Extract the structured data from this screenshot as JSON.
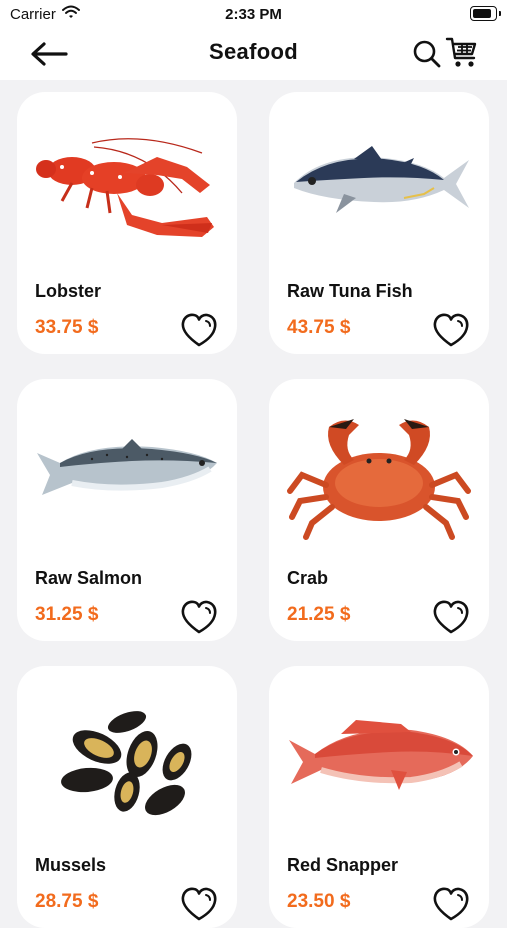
{
  "status_bar": {
    "carrier": "Carrier",
    "time": "2:33 PM"
  },
  "header": {
    "title": "Seafood",
    "back_icon": "arrow-left-icon",
    "search_icon": "search-icon",
    "cart_icon": "cart-icon"
  },
  "colors": {
    "price": "#f26b1d",
    "background": "#f2f2f4",
    "card": "#ffffff"
  },
  "products": [
    {
      "name": "Lobster",
      "price": "33.75 $",
      "image": "lobster"
    },
    {
      "name": "Raw Tuna Fish",
      "price": "43.75 $",
      "image": "tuna"
    },
    {
      "name": "Raw Salmon",
      "price": "31.25 $",
      "image": "salmon"
    },
    {
      "name": "Crab",
      "price": "21.25 $",
      "image": "crab"
    },
    {
      "name": "Mussels",
      "price": "28.75 $",
      "image": "mussels"
    },
    {
      "name": "Red Snapper",
      "price": "23.50 $",
      "image": "snapper"
    }
  ]
}
